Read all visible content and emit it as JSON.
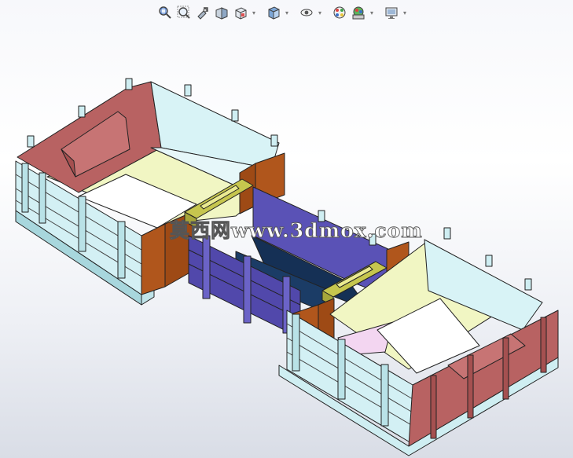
{
  "toolbar": {
    "items": [
      {
        "icon": "zoom-to-fit-icon",
        "has_menu": false
      },
      {
        "icon": "zoom-to-area-icon",
        "has_menu": false
      },
      {
        "icon": "previous-view-icon",
        "has_menu": false
      },
      {
        "icon": "section-view-icon",
        "has_menu": false
      },
      {
        "icon": "view-orientation-icon",
        "has_menu": true
      },
      {
        "icon": "display-style-icon",
        "has_menu": true
      },
      {
        "icon": "hide-show-items-icon",
        "has_menu": true
      },
      {
        "icon": "edit-appearance-icon",
        "has_menu": false
      },
      {
        "icon": "apply-scene-icon",
        "has_menu": true
      },
      {
        "icon": "view-settings-icon",
        "has_menu": true
      }
    ]
  },
  "watermark": {
    "text": "莫西网www.3dmox.com"
  },
  "colors": {
    "background_top": "#ffffff",
    "background_bottom": "#d9dde6",
    "end_wall_red": "#b86262",
    "side_wall_cyan": "#d8f3f6",
    "floor_yellow": "#f1f6c3",
    "blue_panel": "#5a52b6",
    "orange_panel": "#b0561c",
    "olive_beam": "#c6c64e"
  }
}
